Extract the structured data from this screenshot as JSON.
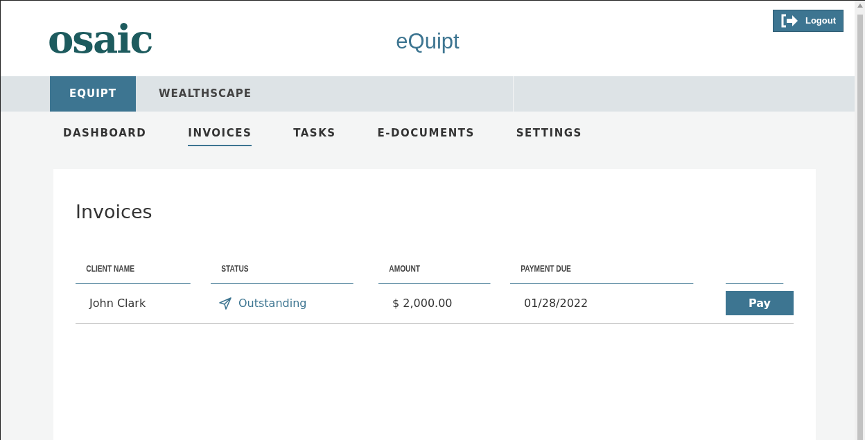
{
  "header": {
    "logo": "osaic",
    "app_title": "eQuipt",
    "logout": "Logout"
  },
  "tabs": [
    {
      "label": "EQUIPT",
      "selected": true
    },
    {
      "label": "WEALTHSCAPE",
      "selected": false
    }
  ],
  "subnav": [
    {
      "label": "DASHBOARD",
      "selected": false
    },
    {
      "label": "INVOICES",
      "selected": true
    },
    {
      "label": "TASKS",
      "selected": false
    },
    {
      "label": "E-DOCUMENTS",
      "selected": false
    },
    {
      "label": "SETTINGS",
      "selected": false
    }
  ],
  "page_title": "Invoices",
  "table": {
    "columns": [
      "CLIENT NAME",
      "STATUS",
      "AMOUNT",
      "PAYMENT DUE"
    ],
    "rows": [
      {
        "client": "John Clark",
        "status": "Outstanding",
        "amount": "$ 2,000.00",
        "due": "01/28/2022",
        "action": "Pay"
      }
    ]
  }
}
